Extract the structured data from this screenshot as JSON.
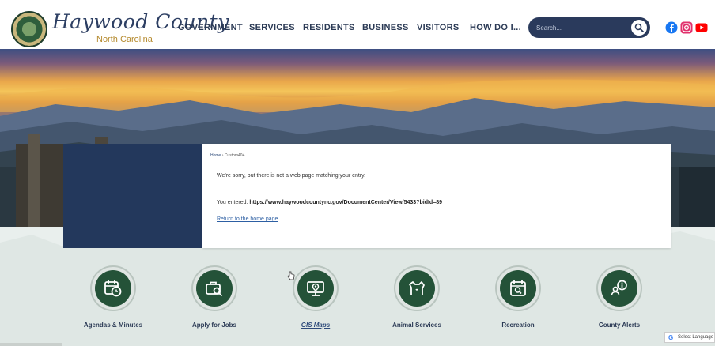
{
  "header": {
    "logo_text": "Haywood County",
    "logo_subtext": "North Carolina"
  },
  "nav": {
    "items": [
      {
        "label": "GOVERNMENT"
      },
      {
        "label": "SERVICES"
      },
      {
        "label": "RESIDENTS"
      },
      {
        "label": "BUSINESS"
      },
      {
        "label": "VISITORS"
      },
      {
        "label": "HOW DO I..."
      }
    ]
  },
  "search": {
    "placeholder": "Search...",
    "icon": "search-icon"
  },
  "social": {
    "facebook_color": "#1877f2",
    "instagram_color": "#e1306c",
    "youtube_color": "#ff0000"
  },
  "content": {
    "breadcrumb_home": "Home",
    "breadcrumb_sep": "›",
    "breadcrumb_current": "Custom404",
    "message": "We're sorry, but there is not a web page matching your entry.",
    "entered_label": "You entered: ",
    "entered_url": "https://www.haywoodcountync.gov/DocumentCenter/View/5433?bidId=89",
    "return_link": "Return to the home page"
  },
  "quick_links": [
    {
      "label": "Agendas & Minutes",
      "icon": "calendar-clock-icon"
    },
    {
      "label": "Apply for Jobs",
      "icon": "briefcase-search-icon"
    },
    {
      "label": "GIS Maps",
      "icon": "map-screen-icon"
    },
    {
      "label": "Animal Services",
      "icon": "animal-icon"
    },
    {
      "label": "Recreation",
      "icon": "calendar-search-icon"
    },
    {
      "label": "County Alerts",
      "icon": "person-alert-icon"
    }
  ],
  "translate": {
    "label": "Select Language"
  },
  "colors": {
    "navy": "#23385c",
    "green": "#245238",
    "accent_gold": "#b58a2e"
  }
}
